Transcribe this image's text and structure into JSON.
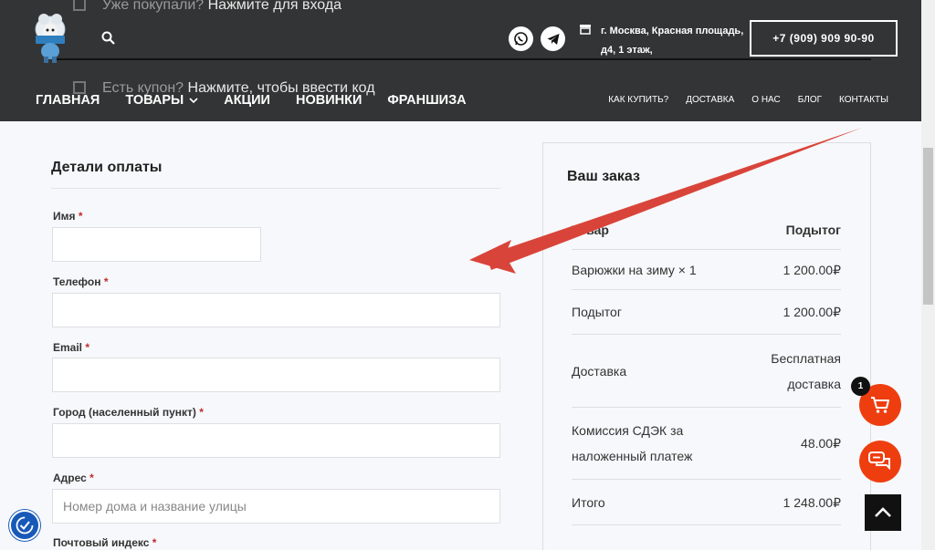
{
  "header": {
    "ghost_login_prefix": "Уже покупали?",
    "ghost_login_link": "Нажмите для входа",
    "ghost_coupon_prefix": "Есть купон?",
    "ghost_coupon_link": "Нажмите, чтобы ввести код",
    "address_line1": "г. Москва, Красная площадь,",
    "address_line2": "д4, 1 этаж,",
    "phone": "+7 (909) 909 90-90",
    "nav_main": [
      "ГЛАВНАЯ",
      "ТОВАРЫ",
      "АКЦИИ",
      "НОВИНКИ",
      "ФРАНШИЗА"
    ],
    "nav_secondary": [
      "КАК КУПИТЬ?",
      "ДОСТАВКА",
      "О НАС",
      "БЛОГ",
      "КОНТАКТЫ"
    ]
  },
  "billing": {
    "title": "Детали оплаты",
    "required_mark": "*",
    "fields": {
      "name": {
        "label": "Имя",
        "value": ""
      },
      "phone": {
        "label": "Телефон",
        "value": ""
      },
      "email": {
        "label": "Email",
        "value": ""
      },
      "city": {
        "label": "Город (населенный пункт)",
        "value": ""
      },
      "address": {
        "label": "Адрес",
        "placeholder": "Номер дома и название улицы"
      },
      "zip": {
        "label": "Почтовый индекс"
      }
    }
  },
  "order": {
    "title": "Ваш заказ",
    "col_product": "Товар",
    "col_subtotal": "Подытог",
    "item_name": "Варюжки на зиму × 1",
    "item_price": "1 200.00₽",
    "subtotal_label": "Подытог",
    "subtotal_value": "1 200.00₽",
    "delivery_label": "Доставка",
    "delivery_value_1": "Бесплатная",
    "delivery_value_2": "доставка",
    "fee_label_1": "Комиссия СДЭК за",
    "fee_label_2": "наложенный платеж",
    "fee_value": "48.00₽",
    "total_label": "Итого",
    "total_value": "1 248.00₽"
  },
  "widgets": {
    "cart_count": "1"
  },
  "colors": {
    "header_bg": "#333435",
    "accent_orange": "#ee3e10",
    "arrow_red": "#d9443a",
    "required_red": "#c02b2b",
    "access_blue": "#1859b8"
  }
}
